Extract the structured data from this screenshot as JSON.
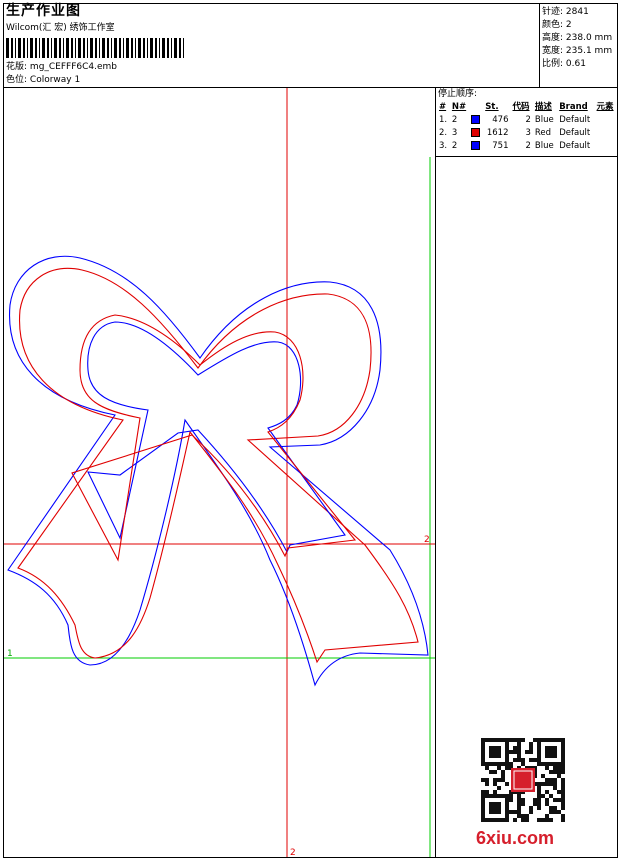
{
  "header": {
    "title": "生产作业图",
    "company": "Wilcom(汇 宏) 绣饰工作室",
    "design_label": "花版:",
    "design_file": "mg_CEFFF6C4.emb",
    "colorway_label": "色位:",
    "colorway": "Colorway 1"
  },
  "specs": [
    {
      "label": "针迹:",
      "value": "2841"
    },
    {
      "label": "颜色:",
      "value": "2"
    },
    {
      "label": "高度:",
      "value": "238.0 mm"
    },
    {
      "label": "宽度:",
      "value": "235.1 mm"
    },
    {
      "label": "比例:",
      "value": "0.61"
    }
  ],
  "stop_sequence": {
    "title": "停止顺序:",
    "columns": [
      "#",
      "N#",
      "St.",
      "代码",
      "描述",
      "Brand",
      "元素"
    ],
    "rows": [
      {
        "index": "1.",
        "needle": "2",
        "color": "#0000ff",
        "stitches": "476",
        "code": "2",
        "desc": "Blue",
        "brand": "Default"
      },
      {
        "index": "2.",
        "needle": "3",
        "color": "#e00000",
        "stitches": "1612",
        "code": "3",
        "desc": "Red",
        "brand": "Default"
      },
      {
        "index": "3.",
        "needle": "2",
        "color": "#0000ff",
        "stitches": "751",
        "code": "2",
        "desc": "Blue",
        "brand": "Default"
      }
    ]
  },
  "guides": {
    "horizontal_red_label": "2",
    "horizontal_green_label": "1",
    "vertical_red_label": "2"
  },
  "colors": {
    "outline_blue": "#0000ff",
    "outline_red": "#e00000",
    "guide_red": "#e00000",
    "guide_green": "#00cc00",
    "brand_red": "#d61f2c"
  },
  "watermark": {
    "brand_text": "6xiu.com"
  }
}
